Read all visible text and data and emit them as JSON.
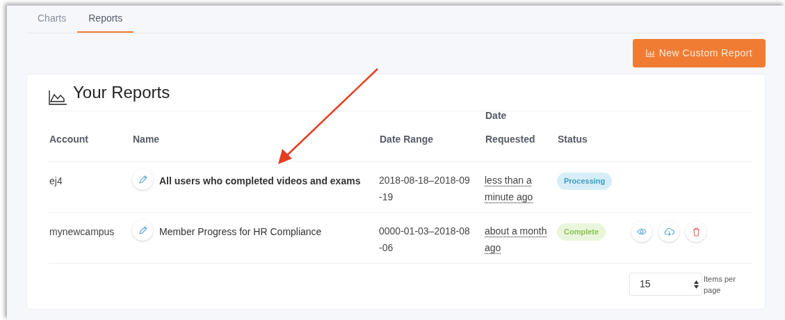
{
  "tabs": [
    {
      "label": "Charts",
      "selected": false
    },
    {
      "label": "Reports",
      "selected": true
    }
  ],
  "new_report_button": {
    "label": "New Custom Report"
  },
  "card": {
    "title": "Your Reports"
  },
  "table": {
    "columns": [
      "Account",
      "Name",
      "Date Range",
      "Date\nRequested",
      "Status"
    ],
    "rows": [
      {
        "account": "ej4",
        "name": "All users who completed videos and exams",
        "emphasized": true,
        "date_range": "2018-08-18–2018-09-19",
        "date_requested": "less than a minute ago",
        "status": {
          "label": "Processing",
          "kind": "processing"
        },
        "has_actions": false
      },
      {
        "account": "mynewcampus",
        "name": "Member Progress for HR Compliance",
        "emphasized": false,
        "date_range": "0000-01-03–2018-08-06",
        "date_requested": "about a month ago",
        "status": {
          "label": "Complete",
          "kind": "complete"
        },
        "has_actions": true
      }
    ]
  },
  "pagination": {
    "value": "15",
    "label": "Items per page"
  }
}
